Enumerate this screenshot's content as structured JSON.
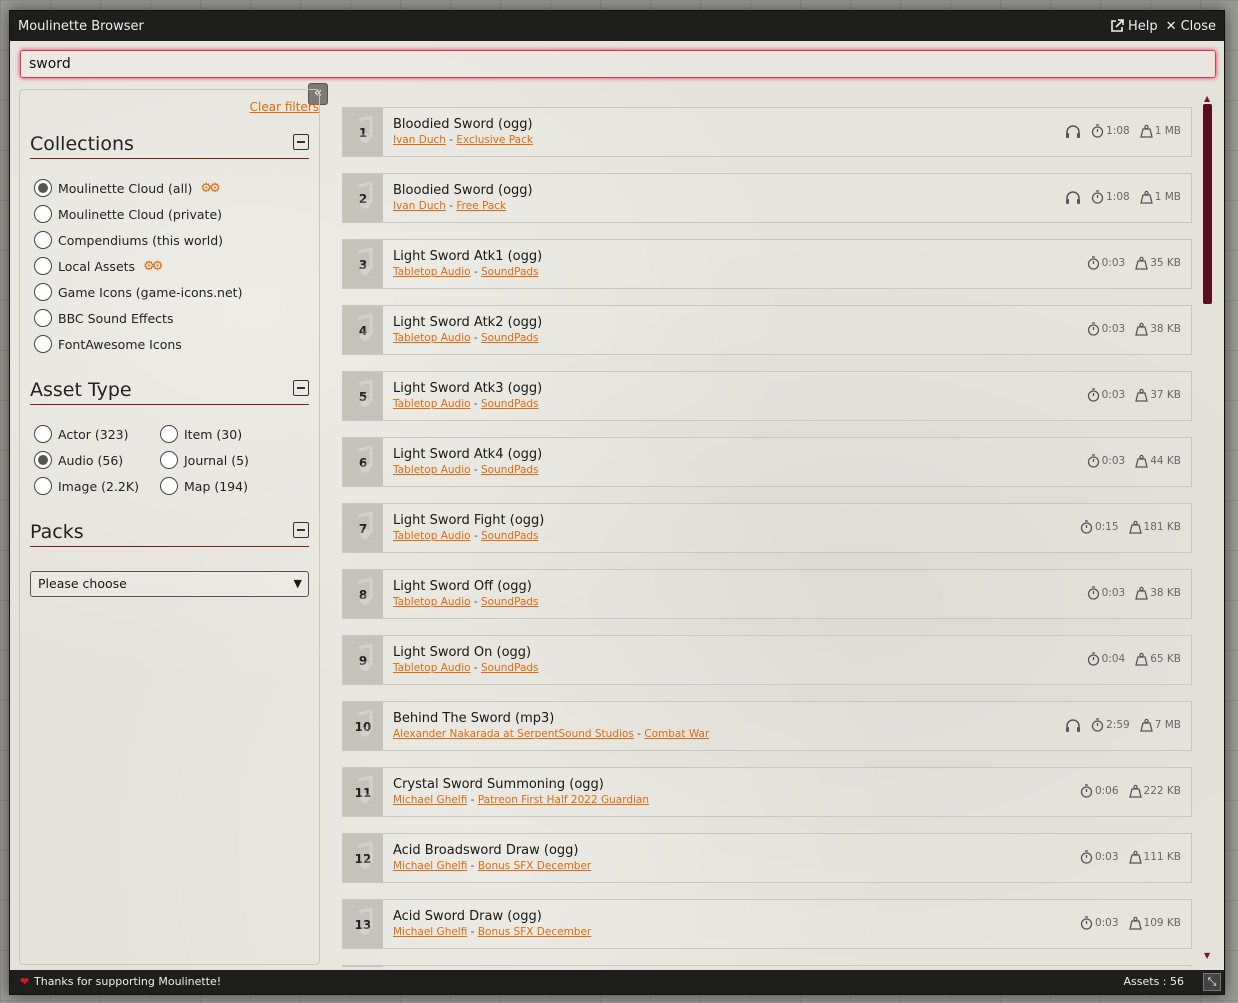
{
  "window": {
    "title": "Moulinette Browser",
    "help_label": "Help",
    "close_label": "Close"
  },
  "search": {
    "value": "sword"
  },
  "sidebar": {
    "collapse_glyph": "«",
    "clear_filters": "Clear filters",
    "collections": {
      "title": "Collections",
      "items": [
        {
          "label": "Moulinette Cloud (all)",
          "selected": true,
          "has_settings": true
        },
        {
          "label": "Moulinette Cloud (private)",
          "selected": false
        },
        {
          "label": "Compendiums (this world)",
          "selected": false
        },
        {
          "label": "Local Assets",
          "selected": false,
          "has_settings": true
        },
        {
          "label": "Game Icons (game-icons.net)",
          "selected": false
        },
        {
          "label": "BBC Sound Effects",
          "selected": false
        },
        {
          "label": "FontAwesome Icons",
          "selected": false
        }
      ]
    },
    "asset_type": {
      "title": "Asset Type",
      "items": [
        {
          "label": "Actor (323)",
          "selected": false
        },
        {
          "label": "Item (30)",
          "selected": false
        },
        {
          "label": "Audio (56)",
          "selected": true
        },
        {
          "label": "Journal (5)",
          "selected": false
        },
        {
          "label": "Image (2.2K)",
          "selected": false
        },
        {
          "label": "Map (194)",
          "selected": false
        }
      ]
    },
    "packs": {
      "title": "Packs",
      "select_value": "Please choose"
    }
  },
  "results": [
    {
      "num": "1",
      "name": "Bloodied Sword (ogg)",
      "creator": "Ivan Duch",
      "pack": "Exclusive Pack",
      "preview": true,
      "duration": "1:08",
      "size": "1 MB"
    },
    {
      "num": "2",
      "name": "Bloodied Sword (ogg)",
      "creator": "Ivan Duch",
      "pack": "Free Pack",
      "preview": true,
      "duration": "1:08",
      "size": "1 MB"
    },
    {
      "num": "3",
      "name": "Light Sword Atk1 (ogg)",
      "creator": "Tabletop Audio",
      "pack": "SoundPads",
      "preview": false,
      "duration": "0:03",
      "size": "35 KB"
    },
    {
      "num": "4",
      "name": "Light Sword Atk2 (ogg)",
      "creator": "Tabletop Audio",
      "pack": "SoundPads",
      "preview": false,
      "duration": "0:03",
      "size": "38 KB"
    },
    {
      "num": "5",
      "name": "Light Sword Atk3 (ogg)",
      "creator": "Tabletop Audio",
      "pack": "SoundPads",
      "preview": false,
      "duration": "0:03",
      "size": "37 KB"
    },
    {
      "num": "6",
      "name": "Light Sword Atk4 (ogg)",
      "creator": "Tabletop Audio",
      "pack": "SoundPads",
      "preview": false,
      "duration": "0:03",
      "size": "44 KB"
    },
    {
      "num": "7",
      "name": "Light Sword Fight (ogg)",
      "creator": "Tabletop Audio",
      "pack": "SoundPads",
      "preview": false,
      "duration": "0:15",
      "size": "181 KB"
    },
    {
      "num": "8",
      "name": "Light Sword Off (ogg)",
      "creator": "Tabletop Audio",
      "pack": "SoundPads",
      "preview": false,
      "duration": "0:03",
      "size": "38 KB"
    },
    {
      "num": "9",
      "name": "Light Sword On (ogg)",
      "creator": "Tabletop Audio",
      "pack": "SoundPads",
      "preview": false,
      "duration": "0:04",
      "size": "65 KB"
    },
    {
      "num": "10",
      "name": "Behind The Sword (mp3)",
      "creator": "Alexander Nakarada at SerpentSound Studios",
      "pack": "Combat War",
      "preview": true,
      "duration": "2:59",
      "size": "7 MB"
    },
    {
      "num": "11",
      "name": "Crystal Sword Summoning (ogg)",
      "creator": "Michael Ghelfi",
      "pack": "Patreon First Half 2022 Guardian",
      "preview": false,
      "duration": "0:06",
      "size": "222 KB"
    },
    {
      "num": "12",
      "name": "Acid Broadsword Draw (ogg)",
      "creator": "Michael Ghelfi",
      "pack": "Bonus SFX December",
      "preview": false,
      "duration": "0:03",
      "size": "111 KB"
    },
    {
      "num": "13",
      "name": "Acid Sword Draw (ogg)",
      "creator": "Michael Ghelfi",
      "pack": "Bonus SFX December",
      "preview": false,
      "duration": "0:03",
      "size": "109 KB"
    }
  ],
  "footer": {
    "thanks": "Thanks for supporting Moulinette!",
    "assets_count": "Assets : 56"
  },
  "colors": {
    "accent": "#e06a0c",
    "section_rule": "#8b1a1a",
    "scrollbar": "#5c0f24"
  }
}
